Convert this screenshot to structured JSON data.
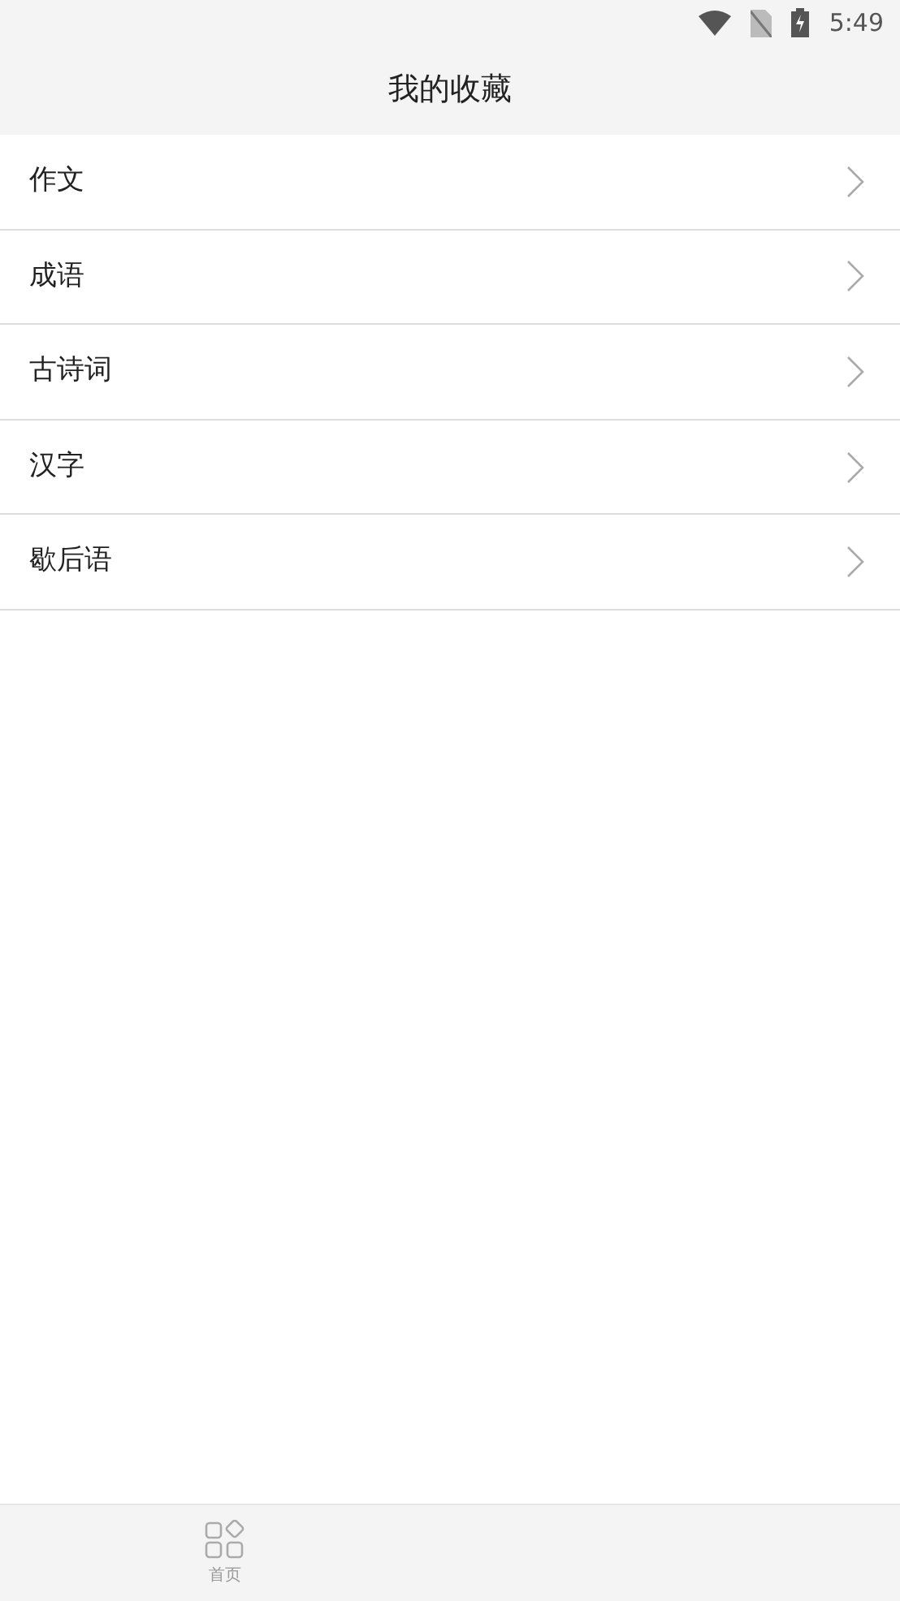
{
  "status_bar": {
    "time": "5:49"
  },
  "header": {
    "title": "我的收藏"
  },
  "items": [
    {
      "label": "作文"
    },
    {
      "label": "成语"
    },
    {
      "label": "古诗词"
    },
    {
      "label": "汉字"
    },
    {
      "label": "歇后语"
    }
  ],
  "tab_bar": [
    {
      "label": "首页",
      "selected": false
    }
  ]
}
